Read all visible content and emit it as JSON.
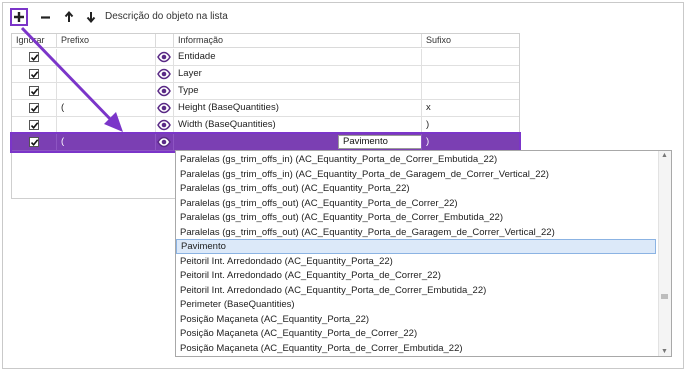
{
  "toolbar": {
    "description_label": "Descrição do objeto na lista"
  },
  "columns": {
    "ignore": "Ignorar",
    "prefix": "Prefixo",
    "info": "Informação",
    "suffix": "Sufixo"
  },
  "rows": [
    {
      "prefix": "",
      "info": "Entidade",
      "suffix": ""
    },
    {
      "prefix": "",
      "info": "Layer",
      "suffix": ""
    },
    {
      "prefix": "",
      "info": "Type",
      "suffix": ""
    },
    {
      "prefix": "(",
      "info": "Height (BaseQuantities)",
      "suffix": "x"
    },
    {
      "prefix": "",
      "info": "Width (BaseQuantities)",
      "suffix": ")"
    },
    {
      "prefix": "(",
      "info": "Pavimento",
      "suffix": ")"
    }
  ],
  "dropdown": {
    "options": [
      "Paralelas (gs_trim_offs_in) (AC_Equantity_Porta_de_Correr_Embutida_22)",
      "Paralelas (gs_trim_offs_in) (AC_Equantity_Porta_de_Garagem_de_Correr_Vertical_22)",
      "Paralelas (gs_trim_offs_out) (AC_Equantity_Porta_22)",
      "Paralelas (gs_trim_offs_out) (AC_Equantity_Porta_de_Correr_22)",
      "Paralelas (gs_trim_offs_out) (AC_Equantity_Porta_de_Correr_Embutida_22)",
      "Paralelas (gs_trim_offs_out) (AC_Equantity_Porta_de_Garagem_de_Correr_Vertical_22)",
      "Pavimento",
      "Peitoril Int. Arredondado (AC_Equantity_Porta_22)",
      "Peitoril Int. Arredondado (AC_Equantity_Porta_de_Correr_22)",
      "Peitoril Int. Arredondado (AC_Equantity_Porta_de_Correr_Embutida_22)",
      "Perimeter (BaseQuantities)",
      "Posição Maçaneta (AC_Equantity_Porta_22)",
      "Posição Maçaneta (AC_Equantity_Porta_de_Correr_22)",
      "Posição Maçaneta (AC_Equantity_Porta_de_Correr_Embutida_22)"
    ],
    "selected_index": 6
  },
  "colors": {
    "accent": "#7b3fb3",
    "annotation": "#7b35c9",
    "eye_icon": "#5a2a86"
  },
  "icons": [
    "add-icon",
    "remove-icon",
    "arrow-up-icon",
    "arrow-down-icon",
    "eye-icon",
    "chevron-down-icon"
  ]
}
